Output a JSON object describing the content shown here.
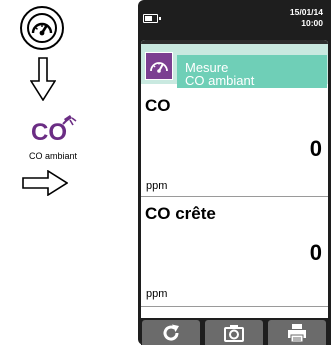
{
  "guide": {
    "co_icon_text": "CO",
    "co_caption": "CO ambiant"
  },
  "status": {
    "date": "15/01/14",
    "time": "10:00"
  },
  "header": {
    "title_line1": "Mesure",
    "title_line2": "CO ambiant",
    "accent_color": "#7b3f91",
    "title_bg_color": "#6fcfb7"
  },
  "readings": [
    {
      "label": "CO",
      "value": "0",
      "unit": "ppm"
    },
    {
      "label": "CO crête",
      "value": "0",
      "unit": "ppm"
    }
  ],
  "toolbar": {
    "buttons": [
      "refresh-icon",
      "camera-icon",
      "printer-icon"
    ]
  }
}
